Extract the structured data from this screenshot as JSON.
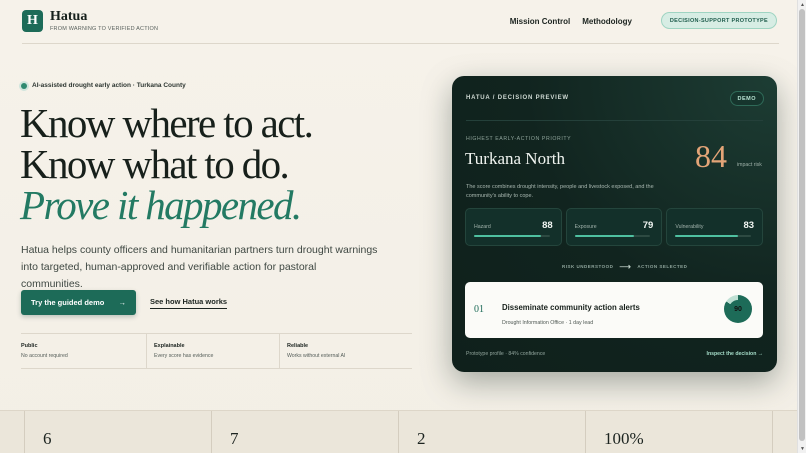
{
  "header": {
    "logo_letter": "H",
    "brand": "Hatua",
    "tagline": "FROM WARNING TO VERIFIED ACTION",
    "nav": [
      "Mission Control",
      "Methodology"
    ],
    "badge": "DECISION-SUPPORT PROTOTYPE"
  },
  "hero": {
    "eyebrow": "AI-assisted drought early action · Turkana County",
    "headline_1": "Know where to act.",
    "headline_2": "Know what to do.",
    "headline_3": "Prove it happened.",
    "lead": "Hatua helps county officers and humanitarian partners turn drought warnings into targeted, human-approved and verifiable action for pastoral communities.",
    "cta_primary": "Try the guided demo",
    "cta_primary_arrow": "→",
    "cta_secondary": "See how Hatua works",
    "features": [
      {
        "title": "Public",
        "sub": "No account required"
      },
      {
        "title": "Explainable",
        "sub": "Every score has evidence"
      },
      {
        "title": "Reliable",
        "sub": "Works without external AI"
      }
    ]
  },
  "card": {
    "title": "HATUA / DECISION PREVIEW",
    "demo": "DEMO",
    "priority_label": "HIGHEST EARLY-ACTION PRIORITY",
    "region": "Turkana North",
    "score": "84",
    "score_unit": "impact risk",
    "description": "The score combines drought intensity, people and livestock exposed, and the community's ability to cope.",
    "metrics": [
      {
        "label": "Hazard",
        "value": "88",
        "fill": 0.88
      },
      {
        "label": "Exposure",
        "value": "79",
        "fill": 0.79
      },
      {
        "label": "Vulnerability",
        "value": "83",
        "fill": 0.83
      }
    ],
    "flow_from": "RISK UNDERSTOOD",
    "flow_arrow": "⟶",
    "flow_to": "ACTION SELECTED",
    "action": {
      "num": "01",
      "title": "Disseminate community action alerts",
      "sub": "Drought Information Office · 1 day lead",
      "ring_value": "90",
      "ring_fill": 0.84
    },
    "footer": "Prototype profile · 84% confidence",
    "inspect": "Inspect the decision →"
  },
  "stats": [
    "6",
    "7",
    "2",
    "100%"
  ],
  "colors": {
    "accent": "#1d6b58",
    "accent_light": "#237a63",
    "score": "#e3a477",
    "card_bg": "#11241f"
  }
}
